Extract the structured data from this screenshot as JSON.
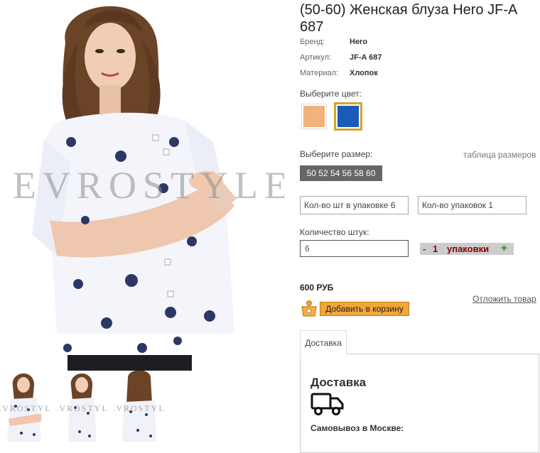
{
  "product": {
    "title": "(50-60) Женская блуза Hero JF-A 687",
    "watermark": "EVROSTYLE",
    "attributes": [
      {
        "label": "Бренд:",
        "value": "Hero"
      },
      {
        "label": "Артикул:",
        "value": "JF-A 687"
      },
      {
        "label": "Материал:",
        "value": "Хлопок"
      }
    ]
  },
  "color": {
    "label": "Выберите цвет:",
    "swatches": [
      "#f1b27c",
      "#1a5cb8"
    ],
    "selected_border": "#d4a52a"
  },
  "size": {
    "label": "Выберите размер:",
    "table_link": "таблица размеров",
    "selected": "50 52 54 56 58 60"
  },
  "packaging": {
    "per_pack": "Кол-во шт в упаковке 6",
    "packs": "Кол-во упаковок 1"
  },
  "quantity": {
    "label": "Количество штук:",
    "value": "6",
    "minus": "-",
    "packs_num": "1",
    "packs_label": "упаковки",
    "plus": "+"
  },
  "price": "600 РУБ",
  "defer_link": "Отложить товар",
  "cart_button": "Добавить в корзину",
  "tabs": [
    {
      "label": "Доставка"
    }
  ],
  "delivery": {
    "title": "Доставка",
    "subtitle": "Самовывоз в Москве:"
  },
  "thumbnails": [
    {
      "watermark": "EVROSTYLE"
    },
    {
      "watermark": "EVROSTYLE"
    },
    {
      "watermark": "EVROSTYLE"
    }
  ]
}
